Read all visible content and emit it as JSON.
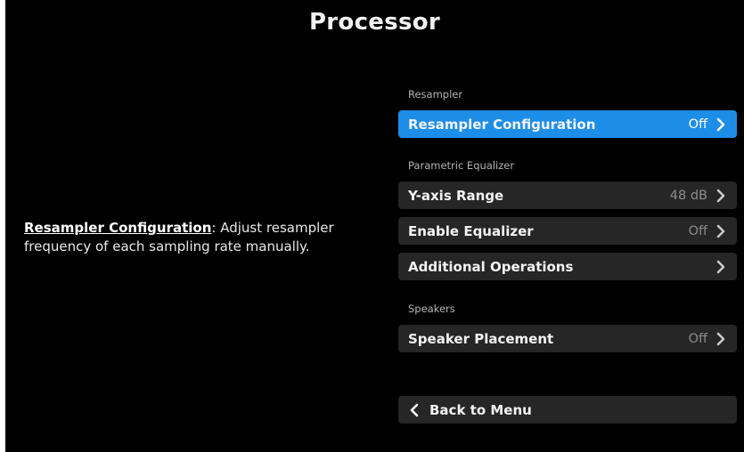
{
  "page": {
    "title": "Processor"
  },
  "description": {
    "name": "Resampler Configuration",
    "text": ": Adjust resampler frequency of each sampling rate manually."
  },
  "sections": {
    "resampler": {
      "label": "Resampler",
      "items": [
        {
          "label": "Resampler Configuration",
          "value": "Off",
          "icon": "chevron-right-icon"
        }
      ]
    },
    "equalizer": {
      "label": "Parametric Equalizer",
      "items": [
        {
          "label": "Y-axis Range",
          "value": "48 dB",
          "icon": "chevron-right-icon"
        },
        {
          "label": "Enable Equalizer",
          "value": "Off",
          "icon": "chevron-right-icon"
        },
        {
          "label": "Additional Operations",
          "value": "",
          "icon": "chevron-right-icon"
        }
      ]
    },
    "speakers": {
      "label": "Speakers",
      "items": [
        {
          "label": "Speaker Placement",
          "value": "Off",
          "icon": "chevron-right-icon"
        }
      ]
    }
  },
  "back": {
    "label": "Back to Menu",
    "icon": "chevron-left-icon"
  },
  "colors": {
    "background": "#000000",
    "selected": "#1d8ee8",
    "row": "#262626",
    "muted_value": "#8c8c8c"
  }
}
